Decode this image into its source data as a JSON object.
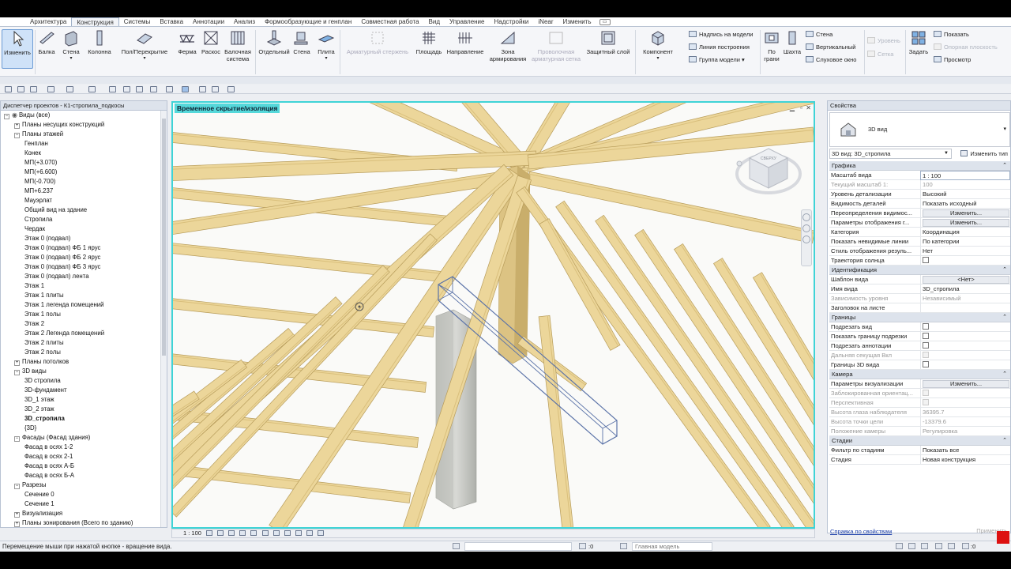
{
  "ribbon_tabs": [
    {
      "label": "Архитектура",
      "active": false
    },
    {
      "label": "Конструкция",
      "active": true
    },
    {
      "label": "Системы",
      "active": false
    },
    {
      "label": "Вставка",
      "active": false
    },
    {
      "label": "Аннотации",
      "active": false
    },
    {
      "label": "Анализ",
      "active": false
    },
    {
      "label": "Формообразующие и генплан",
      "active": false
    },
    {
      "label": "Совместная работа",
      "active": false
    },
    {
      "label": "Вид",
      "active": false
    },
    {
      "label": "Управление",
      "active": false
    },
    {
      "label": "Надстройки",
      "active": false
    },
    {
      "label": "iNear",
      "active": false
    },
    {
      "label": "Изменить",
      "active": false
    }
  ],
  "ribbon": {
    "modify": "Изменить",
    "beam": "Балка",
    "wall": "Стена",
    "column": "Колонна",
    "floor": "Пол/Перекрытие",
    "truss": "Ферма",
    "brace": "Раскос",
    "beam_system_1": "Балочная",
    "beam_system_2": "система",
    "isolated": "Отдельный",
    "wall_found": "Стена",
    "slab": "Плита",
    "rebar": "Арматурный стержень",
    "area": "Площадь",
    "path": "Направление",
    "zone_1": "Зона",
    "zone_2": "армирования",
    "fabric_1": "Проволочная",
    "fabric_2": "арматурная сетка",
    "cover": "Защитный слой",
    "component": "Компонент",
    "model_text": "Надпись на модели",
    "model_line": "Линия  построения",
    "model_group": "Группа модели",
    "by_face_1": "По",
    "by_face_2": "грани",
    "shaft": "Шахта",
    "opening_wall": "Стена",
    "opening_vertical": "Вертикальный",
    "dormer": "Слуховое окно",
    "level": "Уровень",
    "grid": "Сетка",
    "set": "Задать",
    "show": "Показать",
    "ref_plane": "Опорная плоскость",
    "viewer": "Просмотр"
  },
  "project_browser": {
    "title": "Диспетчер проектов - К1-стропила_подкосы",
    "items": [
      {
        "text": "Виды (все)",
        "indent": 0,
        "exp": "−",
        "bold": false
      },
      {
        "text": "Планы несущих конструкций",
        "indent": 1,
        "exp": "+",
        "bold": false
      },
      {
        "text": "Планы этажей",
        "indent": 1,
        "exp": "−",
        "bold": false
      },
      {
        "text": "Генплан",
        "indent": 2,
        "exp": "",
        "bold": false
      },
      {
        "text": "Конек",
        "indent": 2,
        "exp": "",
        "bold": false
      },
      {
        "text": "МП(+3.070)",
        "indent": 2,
        "exp": "",
        "bold": false
      },
      {
        "text": "МП(+6.600)",
        "indent": 2,
        "exp": "",
        "bold": false
      },
      {
        "text": "МП(-0.700)",
        "indent": 2,
        "exp": "",
        "bold": false
      },
      {
        "text": "МП+6.237",
        "indent": 2,
        "exp": "",
        "bold": false
      },
      {
        "text": "Мауэрлат",
        "indent": 2,
        "exp": "",
        "bold": false
      },
      {
        "text": "Общий вид на здание",
        "indent": 2,
        "exp": "",
        "bold": false
      },
      {
        "text": "Стропила",
        "indent": 2,
        "exp": "",
        "bold": false
      },
      {
        "text": "Чердак",
        "indent": 2,
        "exp": "",
        "bold": false
      },
      {
        "text": "Этаж 0 (подвал)",
        "indent": 2,
        "exp": "",
        "bold": false
      },
      {
        "text": "Этаж 0 (подвал) ФБ 1 ярус",
        "indent": 2,
        "exp": "",
        "bold": false
      },
      {
        "text": "Этаж 0 (подвал) ФБ 2 ярус",
        "indent": 2,
        "exp": "",
        "bold": false
      },
      {
        "text": "Этаж 0 (подвал) ФБ 3 ярус",
        "indent": 2,
        "exp": "",
        "bold": false
      },
      {
        "text": "Этаж 0 (подвал) лента",
        "indent": 2,
        "exp": "",
        "bold": false
      },
      {
        "text": "Этаж 1",
        "indent": 2,
        "exp": "",
        "bold": false
      },
      {
        "text": "Этаж 1  плиты",
        "indent": 2,
        "exp": "",
        "bold": false
      },
      {
        "text": "Этаж 1 легенда помещений",
        "indent": 2,
        "exp": "",
        "bold": false
      },
      {
        "text": "Этаж 1 полы",
        "indent": 2,
        "exp": "",
        "bold": false
      },
      {
        "text": "Этаж 2",
        "indent": 2,
        "exp": "",
        "bold": false
      },
      {
        "text": "Этаж 2 Легенда помещений",
        "indent": 2,
        "exp": "",
        "bold": false
      },
      {
        "text": "Этаж 2 плиты",
        "indent": 2,
        "exp": "",
        "bold": false
      },
      {
        "text": "Этаж 2 полы",
        "indent": 2,
        "exp": "",
        "bold": false
      },
      {
        "text": "Планы потолков",
        "indent": 1,
        "exp": "+",
        "bold": false
      },
      {
        "text": "3D виды",
        "indent": 1,
        "exp": "−",
        "bold": false
      },
      {
        "text": "3D стропила",
        "indent": 2,
        "exp": "",
        "bold": false
      },
      {
        "text": "3D-фундамент",
        "indent": 2,
        "exp": "",
        "bold": false
      },
      {
        "text": "3D_1 этаж",
        "indent": 2,
        "exp": "",
        "bold": false
      },
      {
        "text": "3D_2 этаж",
        "indent": 2,
        "exp": "",
        "bold": false
      },
      {
        "text": "3D_стропила",
        "indent": 2,
        "exp": "",
        "bold": true
      },
      {
        "text": "{3D}",
        "indent": 2,
        "exp": "",
        "bold": false
      },
      {
        "text": "Фасады (Фасад здания)",
        "indent": 1,
        "exp": "−",
        "bold": false
      },
      {
        "text": "Фасад в осях 1-2",
        "indent": 2,
        "exp": "",
        "bold": false
      },
      {
        "text": "Фасад в осях 2-1",
        "indent": 2,
        "exp": "",
        "bold": false
      },
      {
        "text": "Фасад в осях А-Б",
        "indent": 2,
        "exp": "",
        "bold": false
      },
      {
        "text": "Фасад в осях Б-А",
        "indent": 2,
        "exp": "",
        "bold": false
      },
      {
        "text": "Разрезы",
        "indent": 1,
        "exp": "−",
        "bold": false
      },
      {
        "text": "Сечение 0",
        "indent": 2,
        "exp": "",
        "bold": false
      },
      {
        "text": "Сечение 1",
        "indent": 2,
        "exp": "",
        "bold": false
      },
      {
        "text": "Визуализация",
        "indent": 1,
        "exp": "+",
        "bold": false
      },
      {
        "text": "Планы зонирования (Всего по зданию)",
        "indent": 1,
        "exp": "+",
        "bold": false
      }
    ]
  },
  "viewport": {
    "label": "Временное скрытие/изоляция",
    "scale": "1 : 100",
    "viewcube_face": "СВЕРХУ",
    "colors": {
      "timber": "#ecd69a",
      "timber_edge": "#b79c5a",
      "concrete": "#c9cbc6",
      "selection": "#3fd3d6"
    }
  },
  "properties": {
    "title": "Свойства",
    "type_name": "3D вид",
    "selector": "3D вид: 3D_стропила",
    "edit_type": "Изменить тип",
    "rows": [
      {
        "section": "Графика"
      },
      {
        "k": "Масштаб вида",
        "v": "1 : 100",
        "kind": "input"
      },
      {
        "k": "Текущий масштаб   1:",
        "v": "100",
        "kind": "grey"
      },
      {
        "k": "Уровень детализации",
        "v": "Высокий"
      },
      {
        "k": "Видимость деталей",
        "v": "Показать исходный"
      },
      {
        "k": "Переопределения видимос...",
        "v": "Изменить...",
        "kind": "button"
      },
      {
        "k": "Параметры отображения г...",
        "v": "Изменить...",
        "kind": "button"
      },
      {
        "k": "Категория",
        "v": "Координация"
      },
      {
        "k": "Показать невидимые линии",
        "v": "По категории"
      },
      {
        "k": "Стиль отображения резуль...",
        "v": "Нет"
      },
      {
        "k": "Траектория солнца",
        "v": "",
        "kind": "check"
      },
      {
        "section": "Идентификация"
      },
      {
        "k": "Шаблон вида",
        "v": "<Нет>",
        "kind": "button"
      },
      {
        "k": "Имя вида",
        "v": "3D_стропила"
      },
      {
        "k": "Зависимость уровня",
        "v": "Независимый",
        "kind": "grey"
      },
      {
        "k": "Заголовок на листе",
        "v": ""
      },
      {
        "section": "Границы"
      },
      {
        "k": "Подрезать вид",
        "v": "",
        "kind": "check"
      },
      {
        "k": "Показать границу подрезки",
        "v": "",
        "kind": "check"
      },
      {
        "k": "Подрезать аннотации",
        "v": "",
        "kind": "check"
      },
      {
        "k": "Дальняя секущая Вкл",
        "v": "",
        "kind": "checkgrey"
      },
      {
        "k": "Границы 3D вида",
        "v": "",
        "kind": "check"
      },
      {
        "section": "Камера"
      },
      {
        "k": "Параметры визуализации",
        "v": "Изменить...",
        "kind": "button"
      },
      {
        "k": "Заблокированная ориентац...",
        "v": "",
        "kind": "checkgrey"
      },
      {
        "k": "Перспективная",
        "v": "",
        "kind": "checkgrey"
      },
      {
        "k": "Высота глаза наблюдателя",
        "v": "36395.7",
        "kind": "grey"
      },
      {
        "k": "Высота точки цели",
        "v": "-13379.6",
        "kind": "grey"
      },
      {
        "k": "Положение камеры",
        "v": "Регулировка",
        "kind": "grey"
      },
      {
        "section": "Стадии"
      },
      {
        "k": "Фильтр по стадиям",
        "v": "Показать все"
      },
      {
        "k": "Стадия",
        "v": "Новая конструкция"
      }
    ],
    "help": "Справка по свойствам",
    "apply": "Применить"
  },
  "status": {
    "message": "Перемещение мыши при нажатой кнопке - вращение вида.",
    "workset_value": ":0",
    "model": "Главная модель",
    "sel_count": ":0"
  }
}
